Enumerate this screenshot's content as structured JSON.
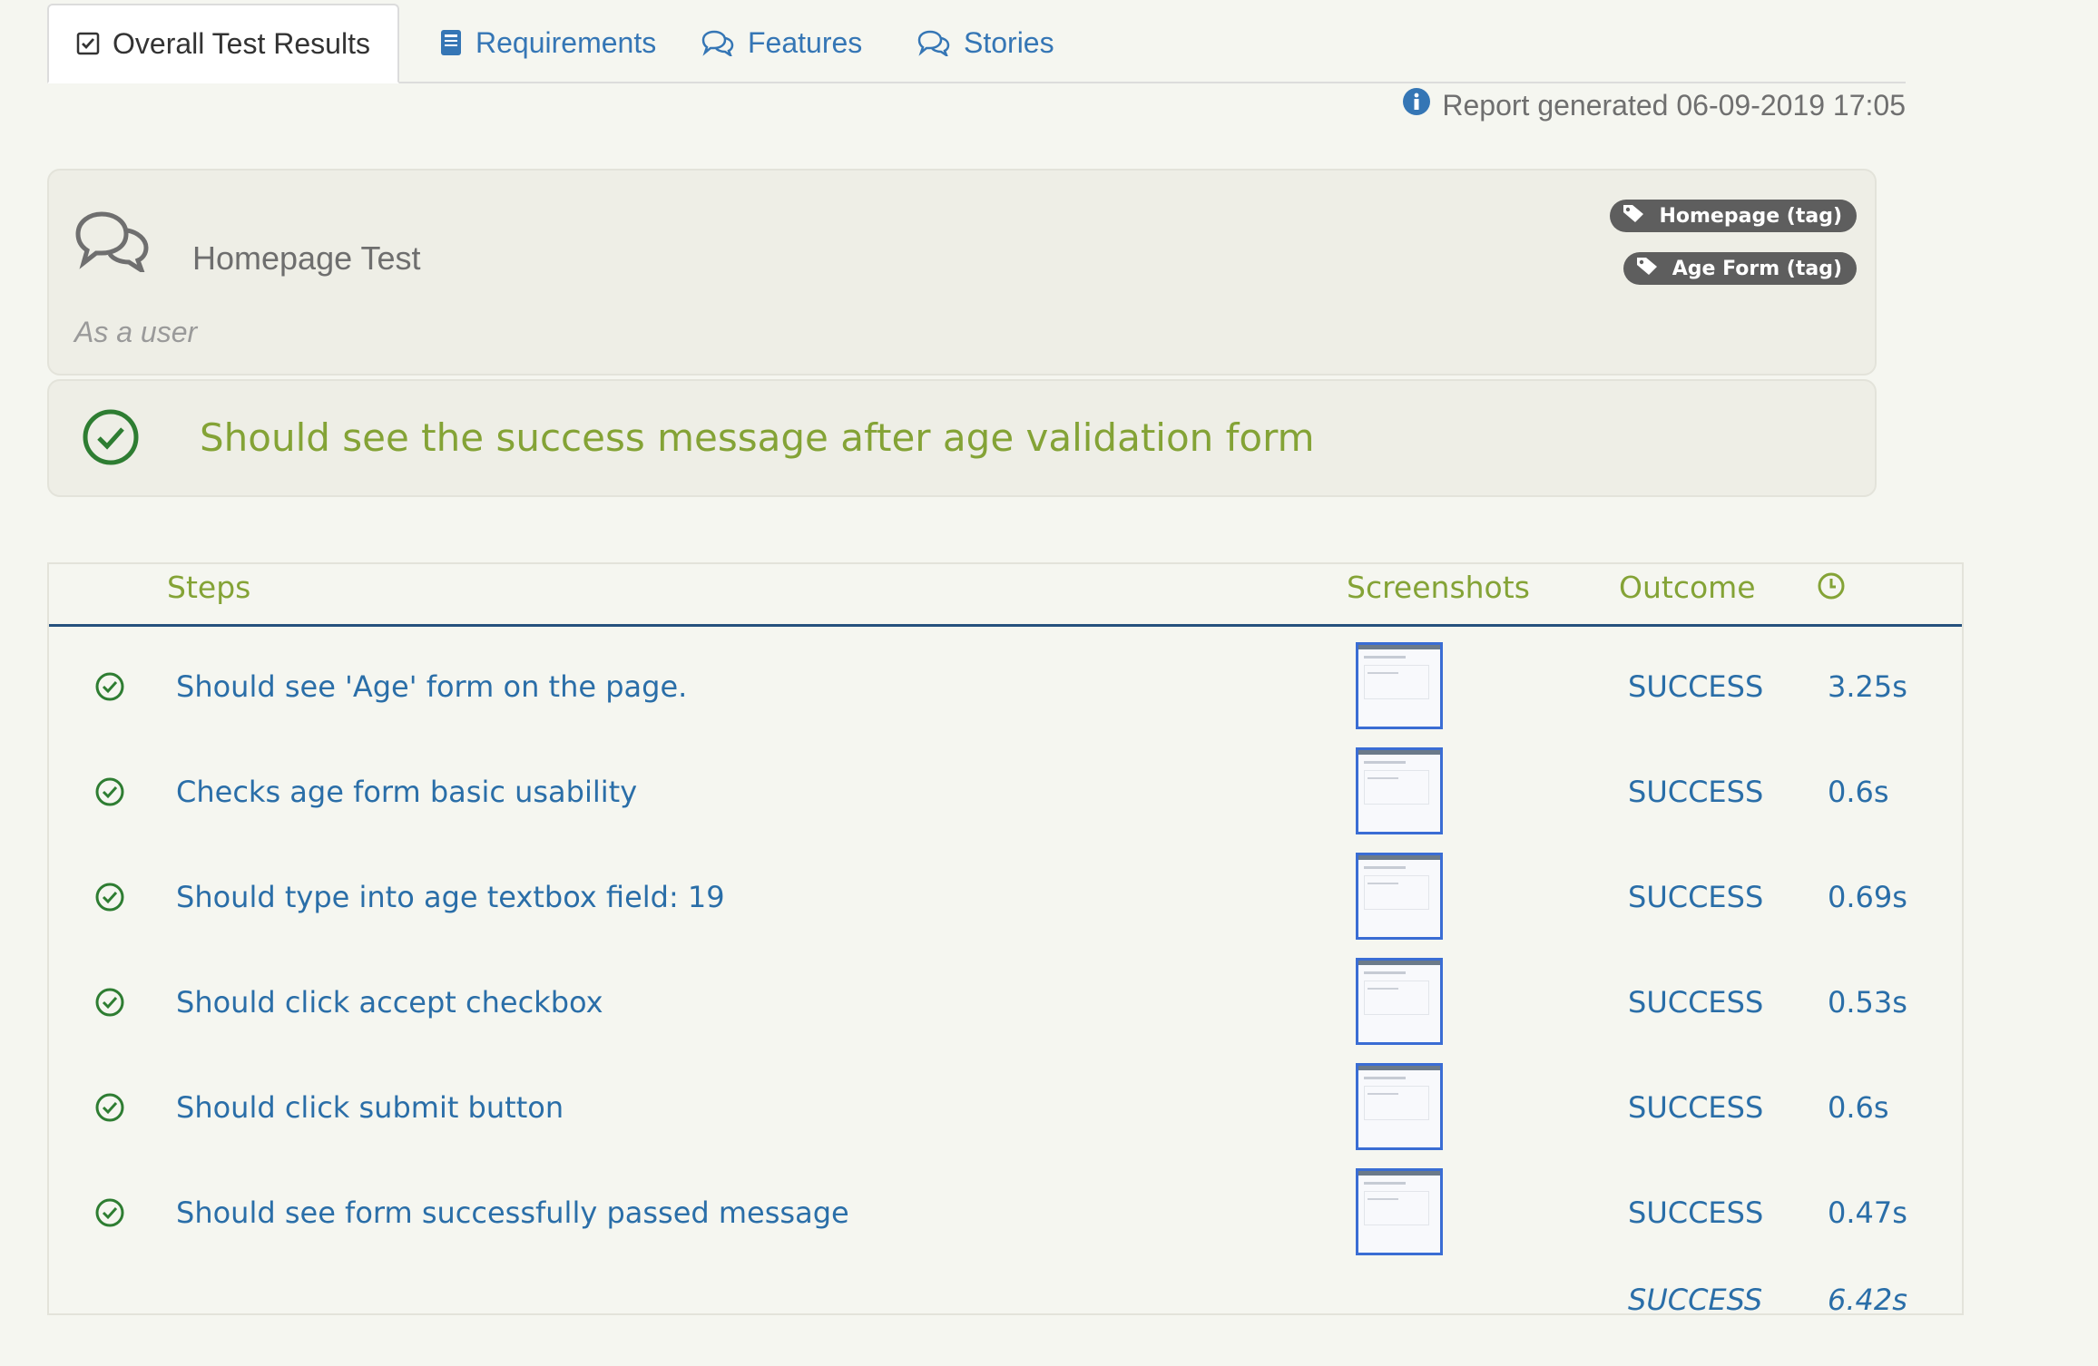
{
  "tabs": [
    {
      "label": "Overall Test Results",
      "icon": "checkbox-icon",
      "active": true
    },
    {
      "label": "Requirements",
      "icon": "book-icon",
      "active": false
    },
    {
      "label": "Features",
      "icon": "comments-icon",
      "active": false
    },
    {
      "label": "Stories",
      "icon": "comments-icon",
      "active": false
    }
  ],
  "report_generated": "Report generated 06-09-2019 17:05",
  "feature": {
    "title": "Homepage Test",
    "subtitle": "As a user",
    "tags": [
      "Homepage (tag)",
      "Age Form (tag)"
    ]
  },
  "scenario": {
    "title": "Should see the success message after age validation form"
  },
  "steps_table": {
    "headers": {
      "steps": "Steps",
      "screenshots": "Screenshots",
      "outcome": "Outcome",
      "duration_icon": "clock-icon"
    },
    "rows": [
      {
        "description": "Should see 'Age' form on the page.",
        "outcome": "SUCCESS",
        "duration": "3.25s"
      },
      {
        "description": "Checks age form basic usability",
        "outcome": "SUCCESS",
        "duration": "0.6s"
      },
      {
        "description": "Should type into age textbox field: 19",
        "outcome": "SUCCESS",
        "duration": "0.69s"
      },
      {
        "description": "Should click accept checkbox",
        "outcome": "SUCCESS",
        "duration": "0.53s"
      },
      {
        "description": "Should click submit button",
        "outcome": "SUCCESS",
        "duration": "0.6s"
      },
      {
        "description": "Should see form successfully passed message",
        "outcome": "SUCCESS",
        "duration": "0.47s"
      }
    ],
    "total": {
      "outcome": "SUCCESS",
      "duration": "6.42s"
    }
  },
  "colors": {
    "success_green": "#84a336",
    "link_blue": "#2a6ea8",
    "check_green": "#2e7d32",
    "tag_bg": "#5e5e5e"
  }
}
